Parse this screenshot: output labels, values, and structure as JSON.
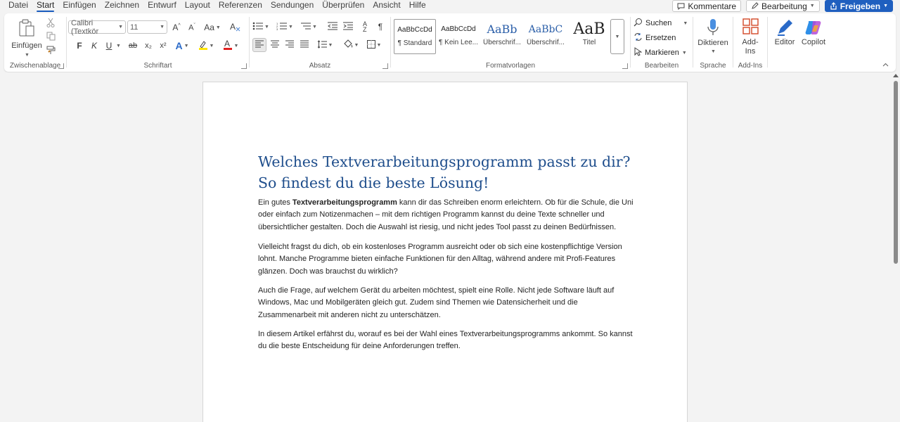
{
  "menu": {
    "tabs": [
      "Datei",
      "Start",
      "Einfügen",
      "Zeichnen",
      "Entwurf",
      "Layout",
      "Referenzen",
      "Sendungen",
      "Überprüfen",
      "Ansicht",
      "Hilfe"
    ],
    "active": "Start"
  },
  "top_buttons": {
    "comments": "Kommentare",
    "editing": "Bearbeitung",
    "share": "Freigeben"
  },
  "ribbon": {
    "clipboard": {
      "paste": "Einfügen",
      "label": "Zwischenablage"
    },
    "font": {
      "font_name": "Calibri (Textkör",
      "font_size": "11",
      "case_label": "Aa",
      "bold": "F",
      "italic": "K",
      "underline": "U",
      "strike": "ab",
      "subscript": "x₂",
      "superscript": "x²",
      "label": "Schriftart"
    },
    "paragraph": {
      "label": "Absatz"
    },
    "styles": {
      "items": [
        {
          "sample": "AaBbCcDd",
          "name": "¶ Standard"
        },
        {
          "sample": "AaBbCcDd",
          "name": "¶ Kein Lee..."
        },
        {
          "sample": "AaBb",
          "name": "Überschrif..."
        },
        {
          "sample": "AaBbC",
          "name": "Überschrif..."
        },
        {
          "sample": "AaB",
          "name": "Titel"
        }
      ],
      "label": "Formatvorlagen"
    },
    "editing": {
      "search": "Suchen",
      "replace": "Ersetzen",
      "select": "Markieren",
      "label": "Bearbeiten"
    },
    "voice": {
      "dictate": "Diktieren",
      "label": "Sprache"
    },
    "addins": {
      "button_line1": "Add-",
      "button_line2": "Ins",
      "label": "Add-Ins"
    },
    "editor": "Editor",
    "copilot": "Copilot"
  },
  "document": {
    "title": "Welches Textverarbeitungsprogramm passt zu dir? So findest du die beste Lösung!",
    "p1_before": "Ein gutes ",
    "p1_bold": "Textverarbeitungsprogramm",
    "p1_after": " kann dir das Schreiben enorm erleichtern. Ob für die Schule, die Uni oder einfach zum Notizenmachen – mit dem richtigen Programm kannst du deine Texte schneller und übersichtlicher gestalten. Doch die Auswahl ist riesig, und nicht jedes Tool passt zu deinen Bedürfnissen.",
    "p2": "Vielleicht fragst du dich, ob ein kostenloses Programm ausreicht oder ob sich eine kostenpflichtige Version lohnt. Manche Programme bieten einfache Funktionen für den Alltag, während andere mit Profi-Features glänzen. Doch was brauchst du wirklich?",
    "p3": "Auch die Frage, auf welchem Gerät du arbeiten möchtest, spielt eine Rolle. Nicht jede Software läuft auf Windows, Mac und Mobilgeräten gleich gut. Zudem sind Themen wie Datensicherheit und die Zusammenarbeit mit anderen nicht zu unterschätzen.",
    "p4": "In diesem Artikel erfährst du, worauf es bei der Wahl eines Textverarbeitungsprogramms ankommt. So kannst du die beste Entscheidung für deine Anforderungen treffen."
  },
  "colors": {
    "accent": "#185abd",
    "title": "#1f4e8c",
    "share_bg": "#1f5fbf"
  }
}
